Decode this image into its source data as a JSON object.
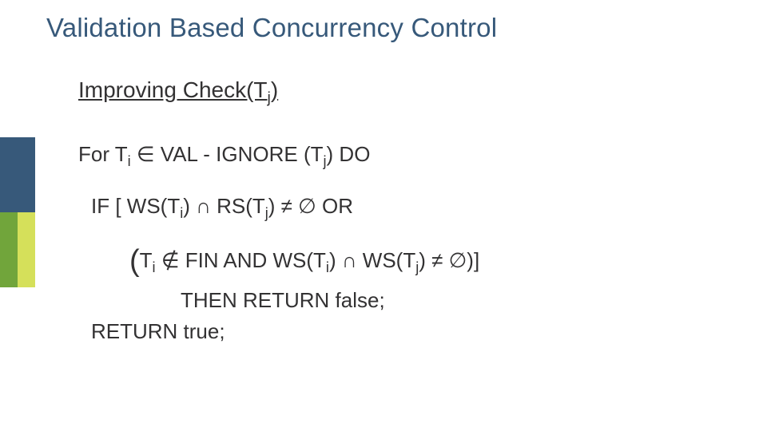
{
  "slide": {
    "title": "Validation Based Concurrency Control",
    "section": {
      "pre": "Improving Check(T",
      "sub": "j",
      "post": ")"
    },
    "l1": {
      "a": "For T",
      "sub1": "i",
      "in": " ∈ ",
      "b": " VAL - IGNORE (T",
      "sub2": "j",
      "c": ")  DO"
    },
    "l2": {
      "a": "IF [ WS(T",
      "sub1": "i",
      "b": ")",
      "cap": " ∩ ",
      "c": " RS(T",
      "sub2": "j",
      "d": ") ≠ ∅ OR"
    },
    "l3": {
      "paren": "(",
      "a": "T",
      "sub1": "i",
      "notin": " ∉ ",
      "b": " FIN  AND WS(T",
      "sub2": "i",
      "c": ")",
      "cap": " ∩ ",
      "d": " WS(T",
      "sub3": "j",
      "e": ") ≠ ∅)]"
    },
    "l4": "THEN RETURN false;",
    "l5": "RETURN true;"
  }
}
